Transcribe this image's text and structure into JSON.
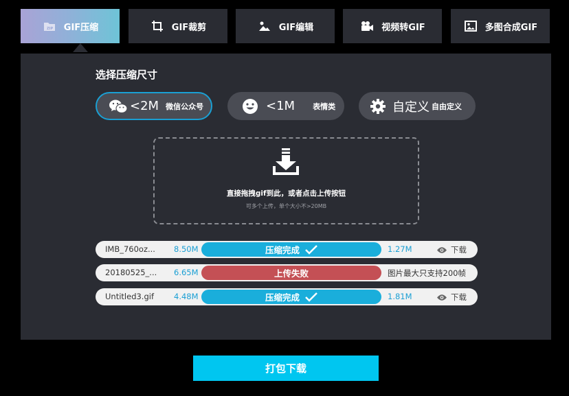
{
  "tabs": [
    {
      "label": "GIF压缩",
      "icon": "zip-folder-icon"
    },
    {
      "label": "GIF裁剪",
      "icon": "crop-icon"
    },
    {
      "label": "GIF编辑",
      "icon": "image-edit-icon"
    },
    {
      "label": "视频转GIF",
      "icon": "video-camera-icon"
    },
    {
      "label": "多图合成GIF",
      "icon": "images-icon"
    }
  ],
  "section_title": "选择压缩尺寸",
  "size_options": [
    {
      "main": "<2M",
      "sub": "微信公众号",
      "icon": "wechat-icon",
      "selected": true
    },
    {
      "main": "<1M",
      "sub": "表情类",
      "icon": "smiley-icon",
      "selected": false
    },
    {
      "main": "自定义",
      "sub": "自由定义",
      "icon": "gear-icon",
      "selected": false
    }
  ],
  "dropzone": {
    "main": "直接拖拽gif到此，或者点击上传按钮",
    "sub": "可多个上传，单个大小不>20MB",
    "icon": "download-tray-icon"
  },
  "files": [
    {
      "name": "IMB_760oz...",
      "size": "8.50M",
      "status": "压缩完成",
      "status_type": "ok",
      "result_size": "1.27M",
      "download": "下载"
    },
    {
      "name": "20180525_...",
      "size": "6.65M",
      "status": "上传失败",
      "status_type": "fail",
      "error": "图片最大只支持200帧"
    },
    {
      "name": "Untitled3.gif",
      "size": "4.48M",
      "status": "压缩完成",
      "status_type": "ok",
      "result_size": "1.81M",
      "download": "下载"
    }
  ],
  "pack_button": "打包下载",
  "colors": {
    "accent": "#1aaedb",
    "error": "#c45055",
    "panel": "#2a2c33",
    "button": "#00c6f0"
  }
}
